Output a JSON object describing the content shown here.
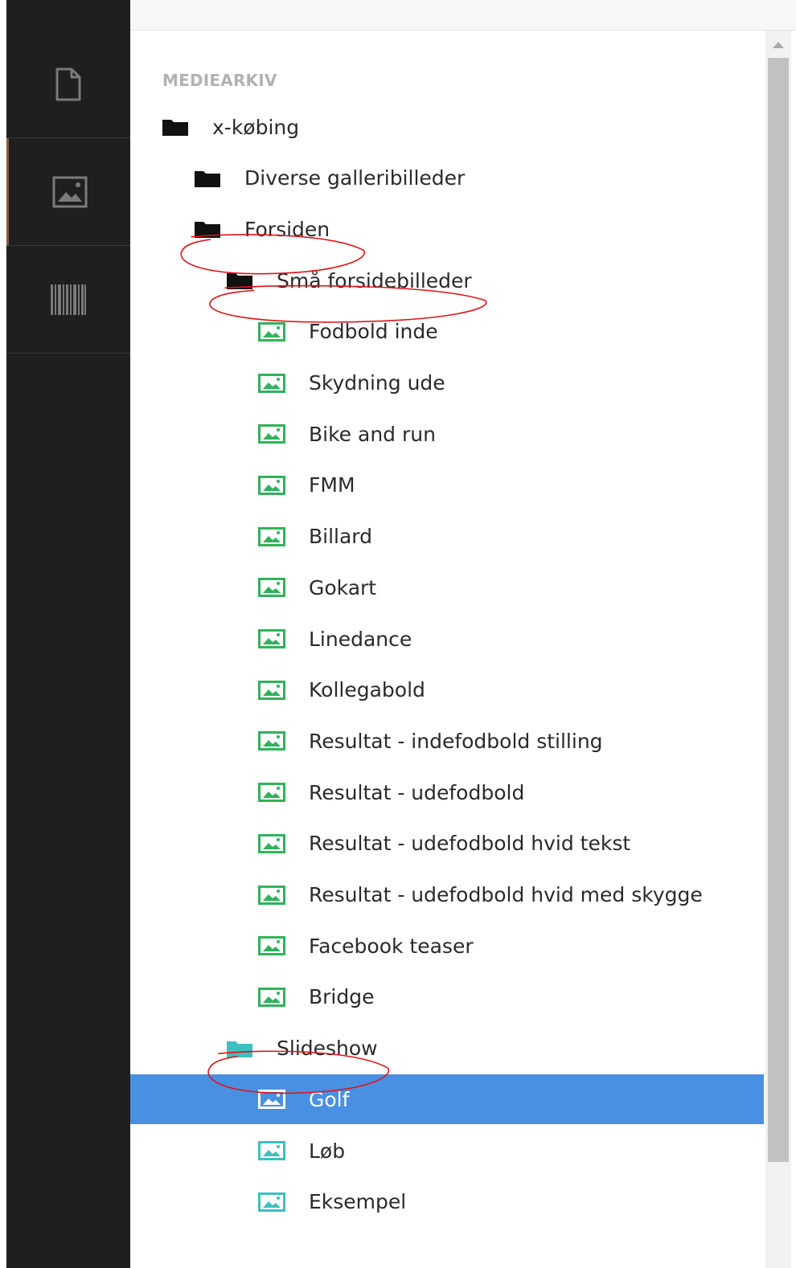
{
  "sidebar": {
    "sections": [
      {
        "name": "content",
        "icon": "document-icon",
        "active": false
      },
      {
        "name": "media",
        "icon": "image-icon",
        "active": true
      },
      {
        "name": "barcode",
        "icon": "barcode-icon",
        "active": false
      }
    ]
  },
  "tree": {
    "heading": "MEDIEARKIV",
    "root": {
      "label": "x-købing",
      "icon": "folder-icon"
    },
    "folder_1": {
      "label": "Diverse galleribilleder",
      "icon": "folder-icon"
    },
    "folder_2": {
      "label": "Forsiden",
      "icon": "folder-icon"
    },
    "folder_3": {
      "label": "Små forsidebilleder",
      "icon": "folder-icon"
    },
    "images_small": [
      "Fodbold inde",
      "Skydning ude",
      "Bike and run",
      "FMM",
      "Billard",
      "Gokart",
      "Linedance",
      "Kollegabold",
      "Resultat - indefodbold stilling",
      "Resultat - udefodbold",
      "Resultat - udefodbold hvid tekst",
      "Resultat - udefodbold hvid med skygge",
      "Facebook teaser",
      "Bridge"
    ],
    "folder_4": {
      "label": "Slideshow",
      "icon": "folder-icon"
    },
    "images_slideshow": [
      {
        "label": "Golf",
        "selected": true
      },
      {
        "label": "Løb",
        "selected": false
      },
      {
        "label": "Eksempel",
        "selected": false
      }
    ]
  },
  "colors": {
    "sidebar_bg": "#1f1f1f",
    "folder_dark": "#111111",
    "folder_teal": "#3fbfbf",
    "image_green": "#2fb35a",
    "image_teal": "#3fbfbf",
    "selection": "#4a90e2",
    "annotation": "#e0141a"
  }
}
